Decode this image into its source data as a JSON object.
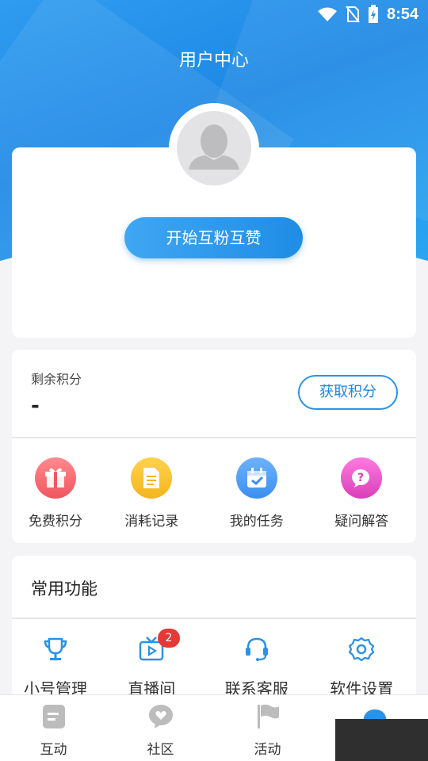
{
  "status_bar": {
    "time": "8:54"
  },
  "header": {
    "title": "用户中心"
  },
  "profile": {
    "start_button": "开始互粉互赞"
  },
  "points": {
    "label": "剩余积分",
    "value": "-",
    "get_button": "获取积分",
    "actions": [
      {
        "label": "免费积分",
        "icon": "gift-icon",
        "color": "#f0565e"
      },
      {
        "label": "消耗记录",
        "icon": "document-icon",
        "color": "#f5b51f"
      },
      {
        "label": "我的任务",
        "icon": "calendar-check-icon",
        "color": "#3b8ff0"
      },
      {
        "label": "疑问解答",
        "icon": "question-chat-icon",
        "color": "#e84fc3"
      }
    ]
  },
  "functions": {
    "title": "常用功能",
    "items": [
      {
        "label": "小号管理",
        "icon": "trophy-icon"
      },
      {
        "label": "直播间",
        "icon": "live-tv-icon",
        "badge": "2"
      },
      {
        "label": "联系客服",
        "icon": "headset-icon"
      },
      {
        "label": "软件设置",
        "icon": "settings-icon"
      }
    ],
    "accent": "#2a93e8"
  },
  "bottom_nav": {
    "items": [
      {
        "label": "互动",
        "icon": "note-icon"
      },
      {
        "label": "社区",
        "icon": "heart-chat-icon"
      },
      {
        "label": "活动",
        "icon": "flag-icon"
      },
      {
        "label": "",
        "icon": "user-center-icon"
      }
    ]
  }
}
